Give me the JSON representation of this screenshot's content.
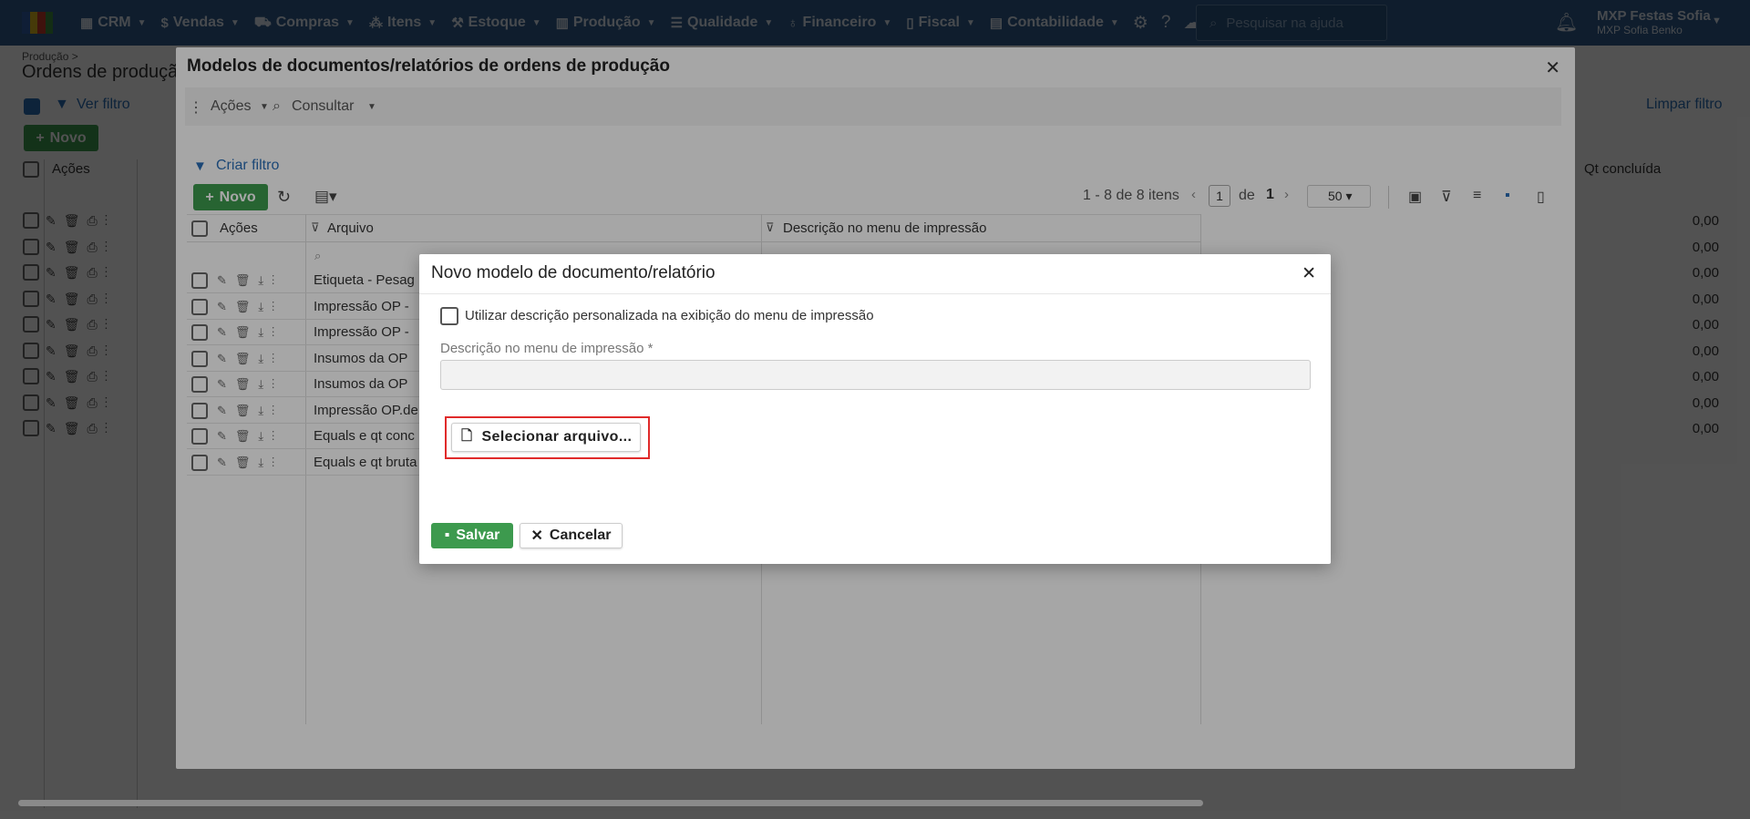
{
  "topbar": {
    "menu": [
      {
        "label": "CRM",
        "icon": "crm-icon"
      },
      {
        "label": "Vendas",
        "icon": "dollar-icon"
      },
      {
        "label": "Compras",
        "icon": "cart-icon"
      },
      {
        "label": "Itens",
        "icon": "items-icon"
      },
      {
        "label": "Estoque",
        "icon": "stock-icon"
      },
      {
        "label": "Produção",
        "icon": "factory-icon"
      },
      {
        "label": "Qualidade",
        "icon": "quality-icon"
      },
      {
        "label": "Financeiro",
        "icon": "finance-icon"
      },
      {
        "label": "Fiscal",
        "icon": "fiscal-icon"
      },
      {
        "label": "Contabilidade",
        "icon": "accounting-icon"
      }
    ],
    "search_placeholder": "Pesquisar na ajuda",
    "company": "MXP Festas Sofia",
    "user": "MXP Sofia Benko"
  },
  "background_page": {
    "breadcrumb": "Produção >",
    "title": "Ordens de produção",
    "filter_link": "Ver filtro",
    "clear_filter": "Limpar filtro",
    "new_button": "Novo",
    "actions_header": "Ações",
    "qty_header": "Qt concluída",
    "qty_values": [
      "0,00",
      "0,00",
      "0,00",
      "0,00",
      "0,00",
      "0,00",
      "0,00",
      "0,00",
      "0,00"
    ]
  },
  "modal1": {
    "title": "Modelos de documentos/relatórios de ordens de produção",
    "toolbar": {
      "actions": "Ações",
      "consult": "Consultar"
    },
    "create_filter": "Criar filtro",
    "new_button": "Novo",
    "pagination": {
      "summary": "1 - 8 de 8 itens",
      "page": "1",
      "of": "de",
      "total": "1",
      "page_size": "50"
    },
    "columns": {
      "actions": "Ações",
      "file": "Arquivo",
      "print_desc": "Descrição no menu de impressão"
    },
    "rows": [
      "Etiqueta - Pesag",
      "Impressão OP -",
      "Impressão OP -",
      "Insumos da OP",
      "Insumos da OP",
      "Impressão OP.de",
      "Equals e qt conc",
      "Equals e qt bruta"
    ]
  },
  "modal2": {
    "title": "Novo modelo de documento/relatório",
    "checkbox_label": "Utilizar descrição personalizada na exibição do menu de impressão",
    "field_label": "Descrição no menu de impressão *",
    "field_value": "",
    "select_file": "Selecionar arquivo...",
    "save": "Salvar",
    "cancel": "Cancelar"
  },
  "colors": {
    "topbar": "#2f5b8a",
    "primary_green": "#3d9a4e",
    "highlight": "#e02a2a",
    "link": "#2a6db5"
  }
}
